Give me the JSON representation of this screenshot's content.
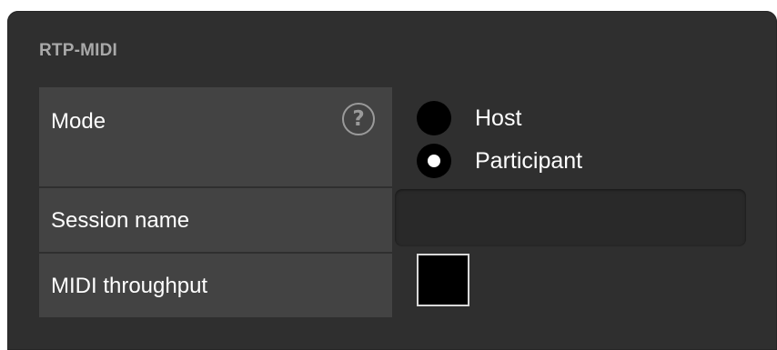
{
  "panel": {
    "title": "RTP-MIDI"
  },
  "mode": {
    "label": "Mode",
    "help_symbol": "?",
    "options": [
      {
        "label": "Host",
        "selected": false
      },
      {
        "label": "Participant",
        "selected": true
      }
    ]
  },
  "session": {
    "label": "Session name",
    "value": "",
    "placeholder": ""
  },
  "throughput": {
    "label": "MIDI throughput",
    "checked": false
  },
  "colors": {
    "panel_bg": "#2f2f2f",
    "label_cell_bg": "#434343",
    "title_text": "#a9a9a9",
    "input_bg": "#292929"
  },
  "icons": {
    "help": "help-icon"
  }
}
